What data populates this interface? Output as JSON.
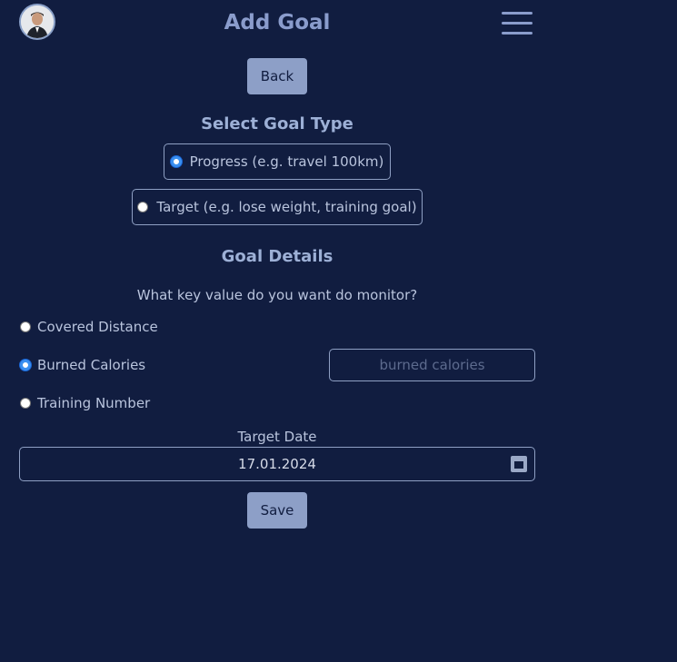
{
  "header": {
    "title": "Add Goal",
    "menu_icon": "hamburger-icon",
    "avatar_icon": "user-avatar"
  },
  "back_label": "Back",
  "goal_type": {
    "heading": "Select Goal Type",
    "options": [
      {
        "label": "Progress (e.g. travel 100km)",
        "selected": true
      },
      {
        "label": "Target (e.g. lose weight, training goal)",
        "selected": false
      }
    ]
  },
  "goal_details": {
    "heading": "Goal Details",
    "question": "What key value do you want do monitor?",
    "metrics": [
      {
        "label": "Covered Distance",
        "selected": false
      },
      {
        "label": "Burned Calories",
        "selected": true
      },
      {
        "label": "Training Number",
        "selected": false
      }
    ],
    "value_placeholder": "burned calories",
    "target_date_label": "Target Date",
    "target_date_value": "17.01.2024",
    "calendar_icon": "calendar-icon"
  },
  "save_label": "Save",
  "colors": {
    "background": "#111d40",
    "button": "#8d9fc7",
    "heading": "#9db0d6",
    "radio_accent": "#3a8ff0"
  }
}
